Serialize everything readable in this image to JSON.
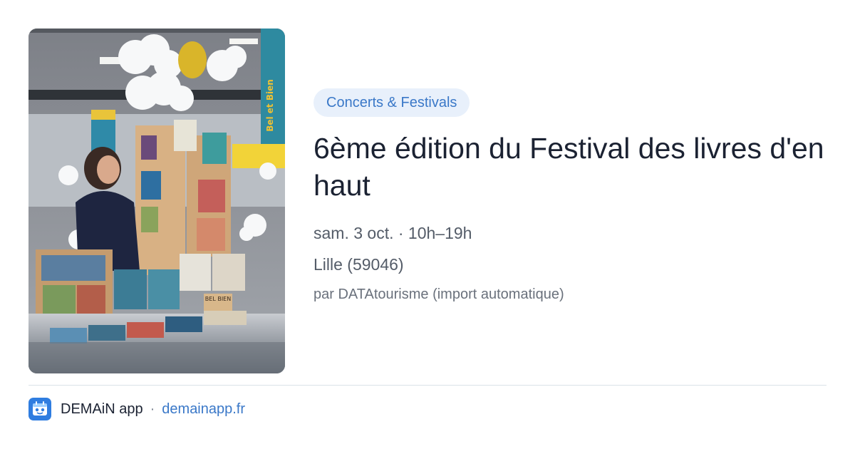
{
  "card": {
    "image_alt": "Stand de livres avec nuages décoratifs",
    "category": "Concerts & Festivals",
    "title": "6ème édition du Festival des livres d'en haut",
    "date": "sam. 3 oct. · 10h–19h",
    "location": "Lille (59046)",
    "source": "par DATAtourisme (import automatique)"
  },
  "photo_signs": {
    "banner_text": "Bel et Bien",
    "box_text": "BEL BIEN"
  },
  "footer": {
    "app_name": "DEMAiN app",
    "separator": "·",
    "domain": "demainapp.fr",
    "app_icon": "demain-app-icon"
  },
  "colors": {
    "accent": "#3a78c8",
    "badge_bg": "#e8f0fb",
    "title": "#1b2232",
    "muted": "#545c68"
  }
}
